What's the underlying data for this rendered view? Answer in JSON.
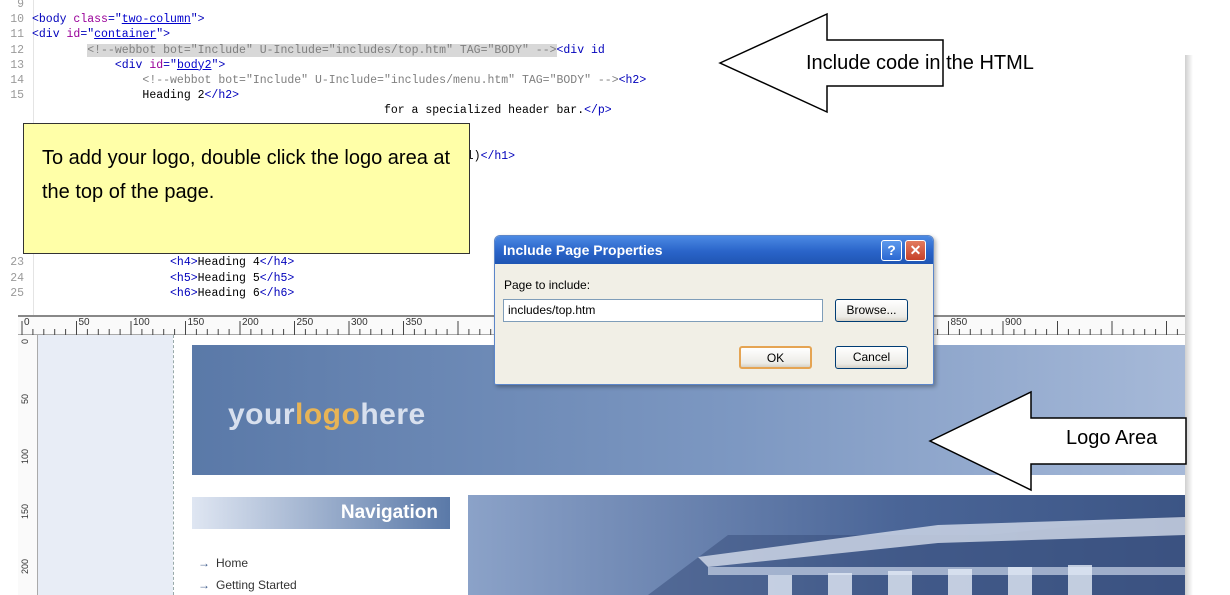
{
  "code_lines": [
    {
      "num": "9",
      "parts": []
    },
    {
      "num": "10",
      "parts": [
        {
          "t": "<body ",
          "c": "tag"
        },
        {
          "t": "class",
          "c": "attr"
        },
        {
          "t": "=\"",
          "c": "tag"
        },
        {
          "t": "two-column",
          "c": "val"
        },
        {
          "t": "\">",
          "c": "tag"
        }
      ]
    },
    {
      "num": "11",
      "parts": [
        {
          "t": "<div ",
          "c": "tag"
        },
        {
          "t": "id",
          "c": "attr"
        },
        {
          "t": "=\"",
          "c": "tag"
        },
        {
          "t": "container",
          "c": "val"
        },
        {
          "t": "\">",
          "c": "tag"
        }
      ]
    },
    {
      "num": "12",
      "parts": [
        {
          "t": "        ",
          "c": "txt"
        },
        {
          "t": "<!--webbot bot=\"Include\" U-Include=\"includes/top.htm\" TAG=\"BODY\" -->",
          "c": "comment hl"
        },
        {
          "t": "<div id",
          "c": "tag"
        }
      ]
    },
    {
      "num": "13",
      "parts": [
        {
          "t": "            ",
          "c": "txt"
        },
        {
          "t": "<div ",
          "c": "tag"
        },
        {
          "t": "id",
          "c": "attr"
        },
        {
          "t": "=\"",
          "c": "tag"
        },
        {
          "t": "body2",
          "c": "val"
        },
        {
          "t": "\">",
          "c": "tag"
        }
      ]
    },
    {
      "num": "14",
      "parts": [
        {
          "t": "                ",
          "c": "txt"
        },
        {
          "t": "<!--webbot bot=\"Include\" U-Include=\"includes/menu.htm\" TAG=\"BODY\" -->",
          "c": "comment"
        },
        {
          "t": "<h2>",
          "c": "tag"
        }
      ]
    },
    {
      "num": "15",
      "parts": [
        {
          "t": "                Heading 2",
          "c": "txt"
        },
        {
          "t": "</h2>",
          "c": "tag"
        }
      ]
    },
    {
      "num": "",
      "parts": [
        {
          "t": "                                                   for a specialized header bar.",
          "c": "txt"
        },
        {
          "t": "</p>",
          "c": "tag"
        }
      ]
    },
    {
      "num": "",
      "parts": []
    },
    {
      "num": "",
      "parts": []
    },
    {
      "num": "",
      "parts": [
        {
          "t": "                                                  ding 1.special)",
          "c": "txt"
        },
        {
          "t": "</h1>",
          "c": "tag"
        }
      ]
    },
    {
      "num": "",
      "parts": []
    },
    {
      "num": "",
      "parts": []
    },
    {
      "num": "",
      "parts": []
    },
    {
      "num": "",
      "parts": []
    },
    {
      "num": "",
      "parts": []
    },
    {
      "num": "",
      "parts": []
    },
    {
      "num": "23",
      "parts": [
        {
          "t": "                    ",
          "c": "txt"
        },
        {
          "t": "<h4>",
          "c": "tag"
        },
        {
          "t": "Heading 4",
          "c": "txt"
        },
        {
          "t": "</h4>",
          "c": "tag"
        }
      ]
    },
    {
      "num": "24",
      "parts": [
        {
          "t": "                    ",
          "c": "txt"
        },
        {
          "t": "<h5>",
          "c": "tag"
        },
        {
          "t": "Heading 5",
          "c": "txt"
        },
        {
          "t": "</h5>",
          "c": "tag"
        }
      ]
    },
    {
      "num": "25",
      "parts": [
        {
          "t": "                    ",
          "c": "txt"
        },
        {
          "t": "<h6>",
          "c": "tag"
        },
        {
          "t": "Heading 6",
          "c": "txt"
        },
        {
          "t": "</h6>",
          "c": "tag"
        }
      ]
    }
  ],
  "ruler": {
    "labels": [
      "0",
      "50",
      "100",
      "150",
      "200",
      "250",
      "300",
      "350",
      "750",
      "800",
      "850",
      "900"
    ]
  },
  "vruler": {
    "labels": [
      "0",
      "50",
      "100",
      "150",
      "200"
    ]
  },
  "callout": {
    "text": "To add your logo, double click the logo area at the top of the page."
  },
  "annotations": {
    "include_code": "Include code in the HTML",
    "logo_area": "Logo Area"
  },
  "dialog": {
    "title": "Include Page Properties",
    "help_glyph": "?",
    "close_glyph": "✕",
    "field_label": "Page to include:",
    "field_value": "includes/top.htm",
    "browse_label": "Browse...",
    "ok_label": "OK",
    "cancel_label": "Cancel"
  },
  "page": {
    "logo_part1": "your",
    "logo_part2": "logo",
    "logo_part3": "here",
    "nav_title": "Navigation",
    "nav_items": [
      "Home",
      "Getting Started"
    ],
    "nav_arrow": "→"
  },
  "colors": {
    "callout_bg": "#ffffa8",
    "banner": "#5a79a8",
    "logo_accent": "#e8b456",
    "dialog_title": "#2a64c9"
  }
}
